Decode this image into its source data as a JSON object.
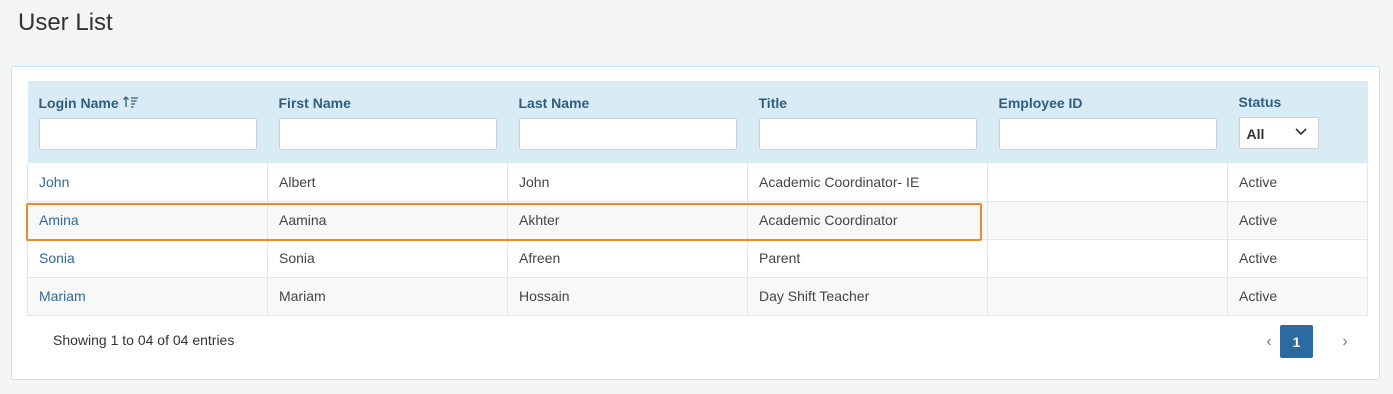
{
  "page": {
    "title": "User List"
  },
  "table": {
    "columns": [
      {
        "label": "Login Name",
        "sortable": true,
        "filter": "text"
      },
      {
        "label": "First Name",
        "filter": "text"
      },
      {
        "label": "Last Name",
        "filter": "text"
      },
      {
        "label": "Title",
        "filter": "text"
      },
      {
        "label": "Employee ID",
        "filter": "text"
      },
      {
        "label": "Status",
        "filter": "select",
        "selected": "All"
      }
    ],
    "rows": [
      {
        "login": "John",
        "first": "Albert",
        "last": "John",
        "title": "Academic Coordinator- IE",
        "employee_id": "",
        "status": "Active"
      },
      {
        "login": "Amina",
        "first": "Aamina",
        "last": "Akhter",
        "title": "Academic Coordinator",
        "employee_id": "",
        "status": "Active",
        "highlighted": true
      },
      {
        "login": "Sonia",
        "first": "Sonia",
        "last": "Afreen",
        "title": "Parent",
        "employee_id": "",
        "status": "Active"
      },
      {
        "login": "Mariam",
        "first": "Mariam",
        "last": "Hossain",
        "title": "Day Shift Teacher",
        "employee_id": "",
        "status": "Active"
      }
    ]
  },
  "footer": {
    "info": "Showing 1 to 04 of 04 entries",
    "pagination": {
      "prev": "‹",
      "current": "1",
      "next": "›"
    }
  },
  "colors": {
    "header_bg": "#d9ebf5",
    "link": "#2f6a9c",
    "highlight": "#ea8a2f",
    "page_active": "#2d6aa0"
  }
}
